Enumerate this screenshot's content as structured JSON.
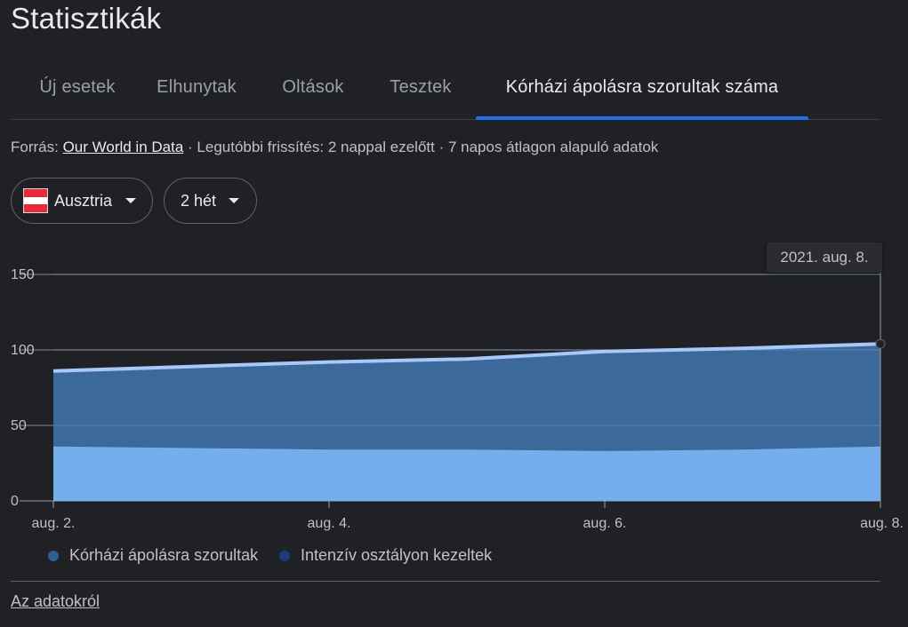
{
  "page": {
    "title": "Statisztikák"
  },
  "tabs": [
    {
      "label": "Új esetek"
    },
    {
      "label": "Elhunytak"
    },
    {
      "label": "Oltások"
    },
    {
      "label": "Tesztek"
    },
    {
      "label": "Kórházi ápolásra szorultak száma",
      "active": true
    }
  ],
  "source": {
    "prefix": "Forrás: ",
    "link": "Our World in Data",
    "rest": " · Legutóbbi frissítés: 2 nappal ezelőtt · 7 napos átlagon alapuló adatok"
  },
  "filters": {
    "country": "Ausztria",
    "period": "2 hét",
    "icon": "dropdown-caret-icon"
  },
  "tooltip": {
    "date": "2021. aug. 8."
  },
  "legend": [
    {
      "label": "Kórházi ápolásra szorultak",
      "color": "#2f5f99"
    },
    {
      "label": "Intenzív osztályon kezeltek",
      "color": "#1a3e79"
    }
  ],
  "footer": {
    "about": "Az adatokról"
  },
  "colors": {
    "hospital_fill": "#3b6a9a",
    "hospital_line": "#a8c7fa",
    "icu_fill": "#74aeed",
    "active_tab": "#1a73e8"
  },
  "chart_data": {
    "type": "area",
    "x": [
      "aug. 2.",
      "aug. 3.",
      "aug. 4.",
      "aug. 5.",
      "aug. 6.",
      "aug. 7.",
      "aug. 8."
    ],
    "x_ticks": [
      "aug. 2.",
      "aug. 4.",
      "aug. 6.",
      "aug. 8."
    ],
    "y_ticks": [
      0,
      50,
      100,
      150
    ],
    "ylim": [
      0,
      150
    ],
    "series": [
      {
        "name": "Kórházi ápolásra szorultak",
        "values": [
          86,
          89,
          92,
          94,
          99,
          101,
          104
        ]
      },
      {
        "name": "Intenzív osztályon kezeltek",
        "values": [
          36,
          35,
          34,
          34,
          33,
          34,
          36
        ]
      }
    ],
    "grid": true,
    "legend": "bottom"
  }
}
